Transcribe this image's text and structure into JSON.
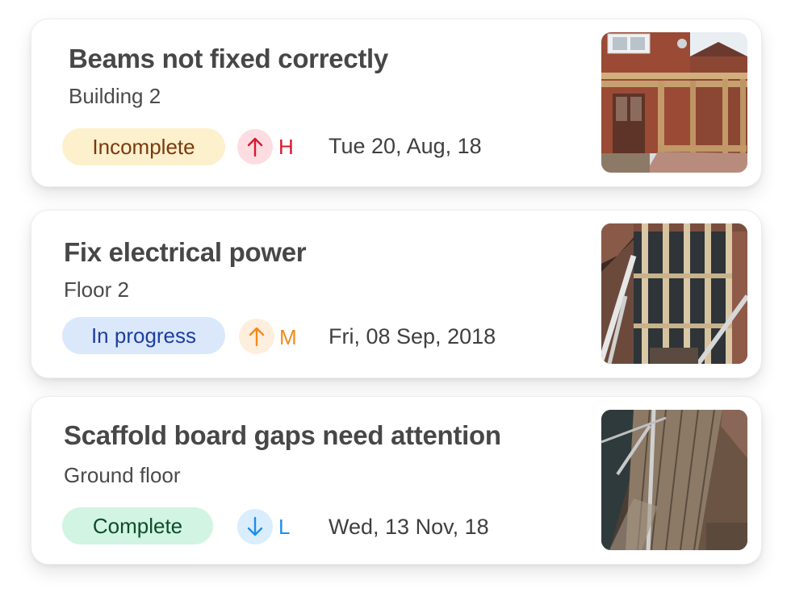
{
  "issues": [
    {
      "title": "Beams not fixed correctly",
      "location": "Building 2",
      "status": "Incomplete",
      "priority_letter": "H",
      "priority_direction": "up",
      "date": "Tue 20, Aug, 18",
      "photo": "house-extension-timber-frame-photo"
    },
    {
      "title": "Fix electrical power",
      "location": "Floor 2",
      "status": "In progress",
      "priority_letter": "M",
      "priority_direction": "up",
      "date": "Fri, 08 Sep, 2018",
      "photo": "loft-stud-wall-photo"
    },
    {
      "title": "Scaffold board gaps need attention",
      "location": "Ground floor",
      "status": "Complete",
      "priority_letter": "L",
      "priority_direction": "down",
      "date": "Wed, 13 Nov, 18",
      "photo": "scaffold-boards-photo"
    }
  ],
  "colors": {
    "incomplete_bg": "#fdf0cc",
    "incomplete_text": "#7a3a10",
    "in_progress_bg": "#dbe8fb",
    "in_progress_text": "#1d3f9e",
    "complete_bg": "#d2f4e2",
    "complete_text": "#0c4d2c",
    "priority_high": "#d8182e",
    "priority_high_bg": "#fddde2",
    "priority_medium": "#f08c19",
    "priority_medium_bg": "#fdeede",
    "priority_low": "#1e8ee8",
    "priority_low_bg": "#daedfc"
  }
}
